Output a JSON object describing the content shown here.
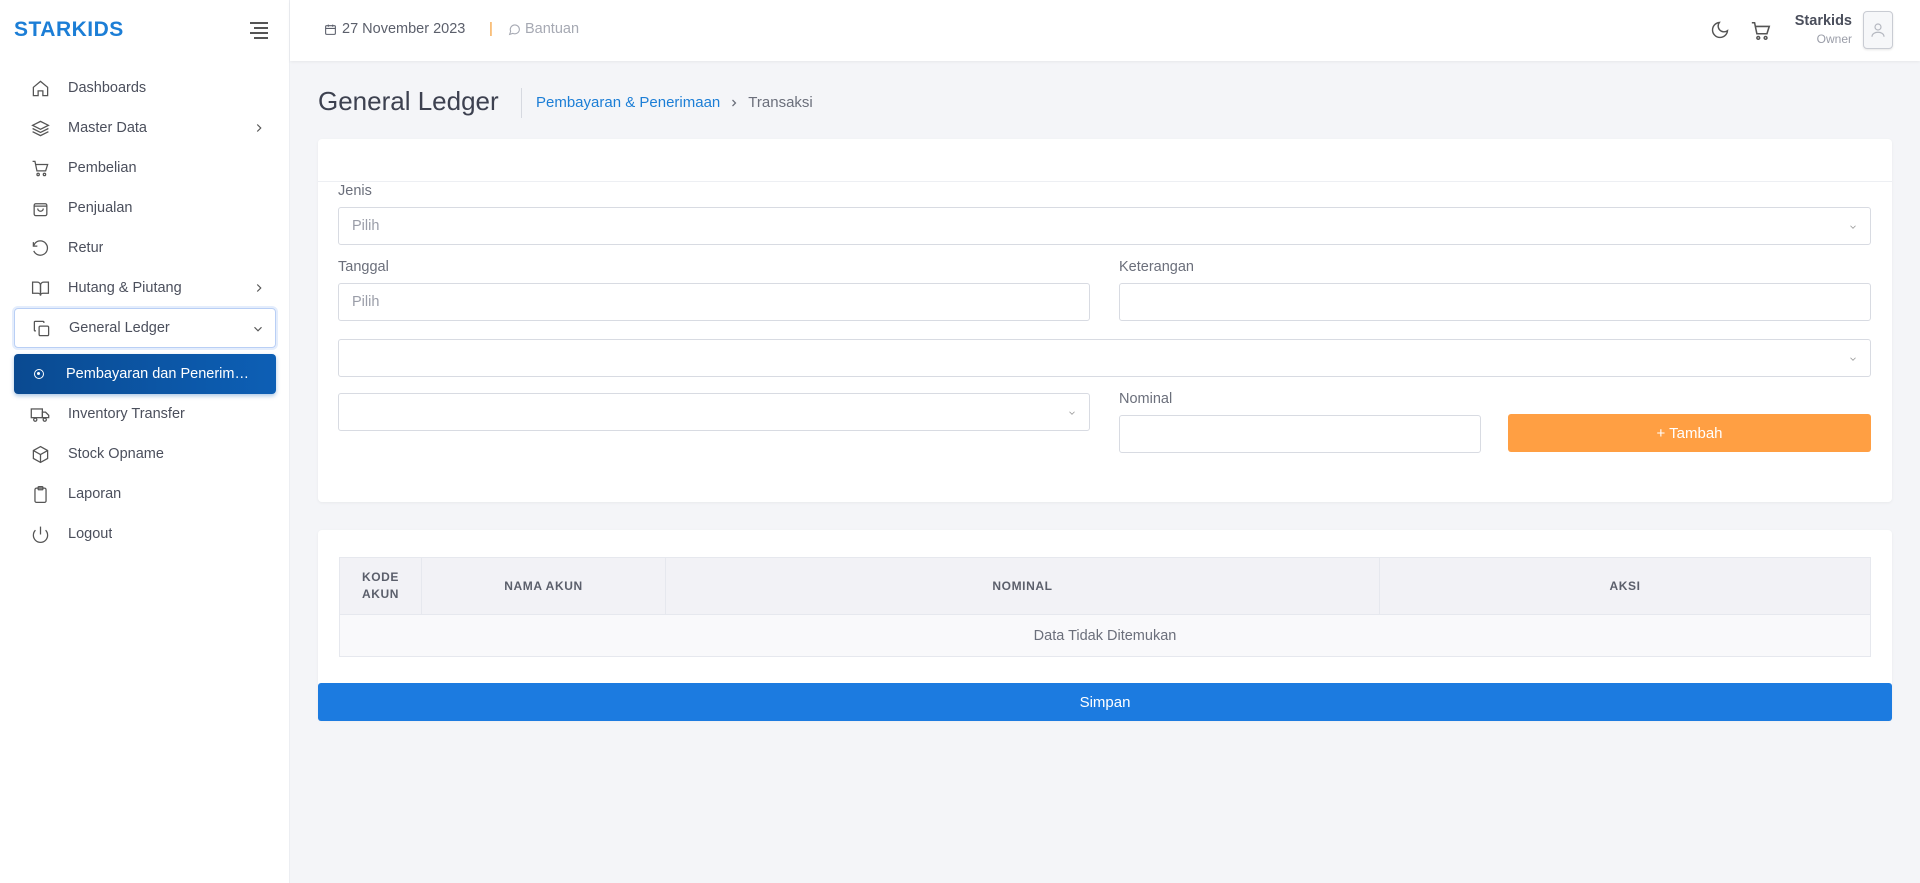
{
  "app": {
    "brand": "STARKIDS"
  },
  "sidebar": {
    "items": [
      {
        "label": "Dashboards",
        "icon": "home-icon"
      },
      {
        "label": "Master Data",
        "icon": "layers-icon",
        "has_children": true
      },
      {
        "label": "Pembelian",
        "icon": "cart-icon"
      },
      {
        "label": "Penjualan",
        "icon": "shopping-bag-icon"
      },
      {
        "label": "Retur",
        "icon": "rotate-ccw-icon"
      },
      {
        "label": "Hutang & Piutang",
        "icon": "book-open-icon",
        "has_children": true
      },
      {
        "label": "General Ledger",
        "icon": "copy-icon",
        "has_children": true,
        "expanded": true
      },
      {
        "label": "Pembayaran dan Penerimaan",
        "icon": "circle-dot-icon",
        "active": true
      },
      {
        "label": "Inventory Transfer",
        "icon": "truck-icon"
      },
      {
        "label": "Stock Opname",
        "icon": "box-icon"
      },
      {
        "label": "Laporan",
        "icon": "clipboard-icon"
      },
      {
        "label": "Logout",
        "icon": "power-icon"
      }
    ]
  },
  "topbar": {
    "date": "27 November 2023",
    "separator": "|",
    "help": "Bantuan",
    "user_name": "Starkids",
    "user_role": "Owner"
  },
  "page": {
    "title": "General Ledger",
    "breadcrumb_link": "Pembayaran & Penerimaan",
    "breadcrumb_current": "Transaksi"
  },
  "form": {
    "jenis_label": "Jenis",
    "jenis_placeholder": "Pilih",
    "tanggal_label": "Tanggal",
    "tanggal_placeholder": "Pilih",
    "keterangan_label": "Keterangan",
    "keterangan_value": "",
    "select_akun_value": "",
    "select_akun2_value": "",
    "nominal_label": "Nominal",
    "nominal_value": "",
    "add_button": "+ Tambah"
  },
  "table": {
    "columns": [
      "KODE AKUN",
      "NAMA AKUN",
      "NOMINAL",
      "AKSI"
    ],
    "empty_text": "Data Tidak Ditemukan"
  },
  "actions": {
    "save_button": "Simpan"
  },
  "colors": {
    "brand": "#1c7ed6",
    "active_nav": "#0d5fb5",
    "add_button": "#ff9f43",
    "save_button": "#1c7be0",
    "date_separator": "#f59f3a"
  }
}
